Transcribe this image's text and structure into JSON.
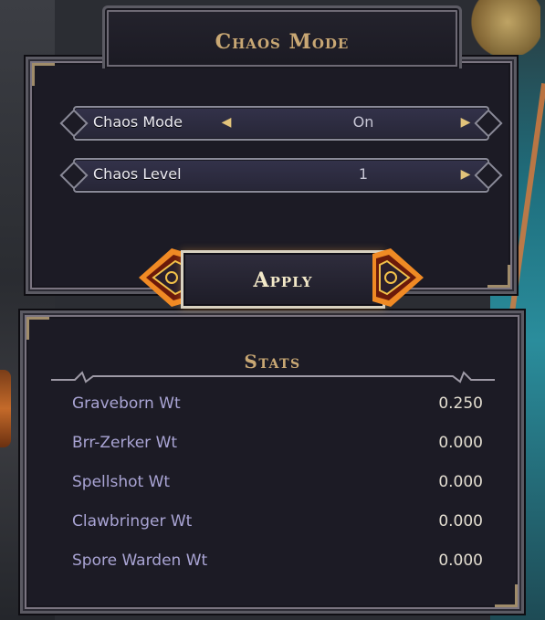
{
  "header": {
    "title": "Chaos Mode"
  },
  "options": [
    {
      "label": "Chaos Mode",
      "value": "On"
    },
    {
      "label": "Chaos Level",
      "value": "1"
    }
  ],
  "apply": {
    "label": "Apply"
  },
  "stats": {
    "title": "Stats",
    "rows": [
      {
        "name": "Graveborn Wt",
        "value": "0.250"
      },
      {
        "name": "Brr-Zerker Wt",
        "value": "0.000"
      },
      {
        "name": "Spellshot Wt",
        "value": "0.000"
      },
      {
        "name": "Clawbringer Wt",
        "value": "0.000"
      },
      {
        "name": "Spore Warden Wt",
        "value": "0.000"
      }
    ]
  },
  "colors": {
    "title_gold": "#c9a874",
    "panel_bg": "#1c1b25",
    "stat_name": "#a9a4d4",
    "arrow_gold": "#e2c37a",
    "flame_orange": "#f08a24"
  }
}
